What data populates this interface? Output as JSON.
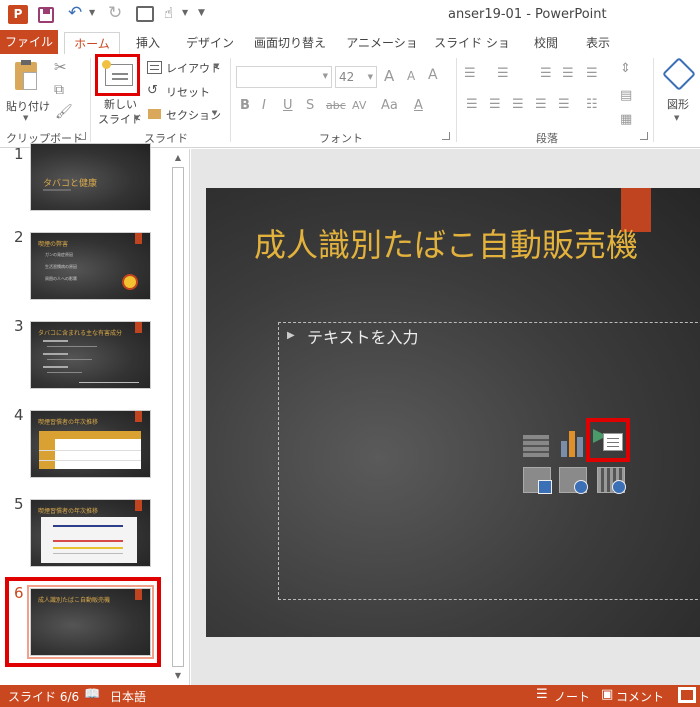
{
  "window": {
    "title": "anser19-01 - PowerPoint",
    "app_letter": "P"
  },
  "tabs": [
    {
      "label": "ファイル"
    },
    {
      "label": "ホーム"
    },
    {
      "label": "挿入"
    },
    {
      "label": "デザイン"
    },
    {
      "label": "画面切り替え"
    },
    {
      "label": "アニメーション"
    },
    {
      "label": "スライド ショー"
    },
    {
      "label": "校閲"
    },
    {
      "label": "表示"
    }
  ],
  "ribbon": {
    "clipboard": {
      "paste": "貼り付け",
      "group": "クリップボード"
    },
    "slides": {
      "new_slide_line1": "新しい",
      "new_slide_line2": "スライド",
      "layout": "レイアウト",
      "reset": "リセット",
      "section": "セクション",
      "group": "スライド"
    },
    "font": {
      "size": "42",
      "group": "フォント",
      "grow": "A",
      "shrink": "A",
      "bold": "B",
      "italic": "I",
      "underline": "U",
      "shadow": "S",
      "strike": "abc",
      "spacing": "AV",
      "case": "Aa",
      "clear": "A"
    },
    "paragraph": {
      "group": "段落"
    },
    "drawing": {
      "shapes": "図形"
    }
  },
  "thumbnails": [
    {
      "num": "1",
      "title": "タバコと健康"
    },
    {
      "num": "2",
      "title": "喫煙の弊害"
    },
    {
      "num": "3",
      "title": "タバコに含まれる主な有害成分"
    },
    {
      "num": "4",
      "title": "喫煙習慣者の年次推移"
    },
    {
      "num": "5",
      "title": "喫煙習慣者の年次推移"
    },
    {
      "num": "6",
      "title": "成人識別たばこ自動販売機"
    }
  ],
  "thumb2_bullets": [
    "ガンの発症原因",
    "生活習慣病の原因",
    "周囲の人への影響"
  ],
  "slide": {
    "title": "成人識別たばこ自動販売機",
    "placeholder": "テキストを入力"
  },
  "status": {
    "slide": "スライド 6/6",
    "language": "日本語",
    "notes": "ノート",
    "comments": "コメント"
  },
  "colors": {
    "accent": "#c9481f",
    "highlight": "#e00000",
    "slide_title": "#e3b23c"
  }
}
